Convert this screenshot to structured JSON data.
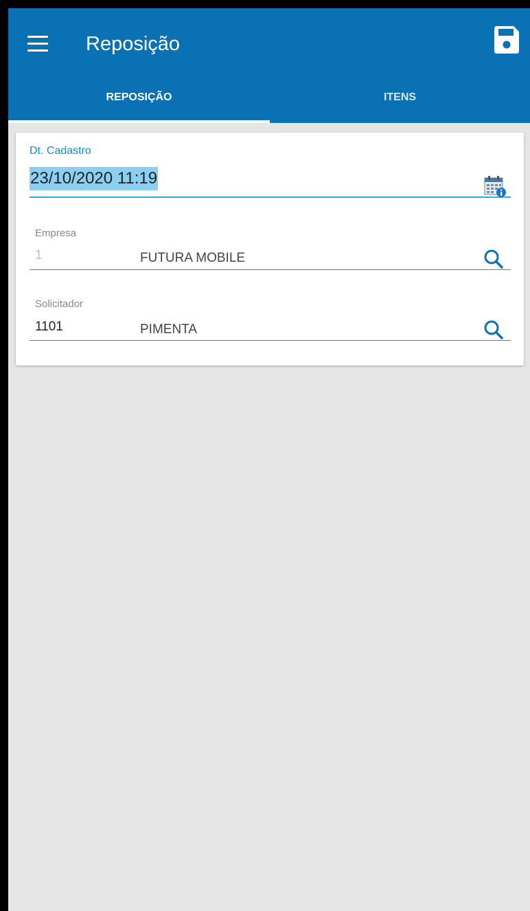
{
  "header": {
    "title": "Reposição",
    "menu_icon": "hamburger-menu-icon",
    "save_icon": "floppy-disk-save-icon",
    "color": "#0a72b4"
  },
  "tabs": [
    {
      "label": "REPOSIÇÃO",
      "active": true
    },
    {
      "label": "ITENS",
      "active": false
    }
  ],
  "form": {
    "dt_cadastro": {
      "label": "Dt. Cadastro",
      "value": "23/10/2020 11:19",
      "icon": "calendar-info-icon"
    },
    "empresa": {
      "label": "Empresa",
      "code": "1",
      "name": "FUTURA MOBILE",
      "icon": "search-icon"
    },
    "solicitador": {
      "label": "Solicitador",
      "code": "1101",
      "name": "PIMENTA",
      "icon": "search-icon"
    }
  }
}
